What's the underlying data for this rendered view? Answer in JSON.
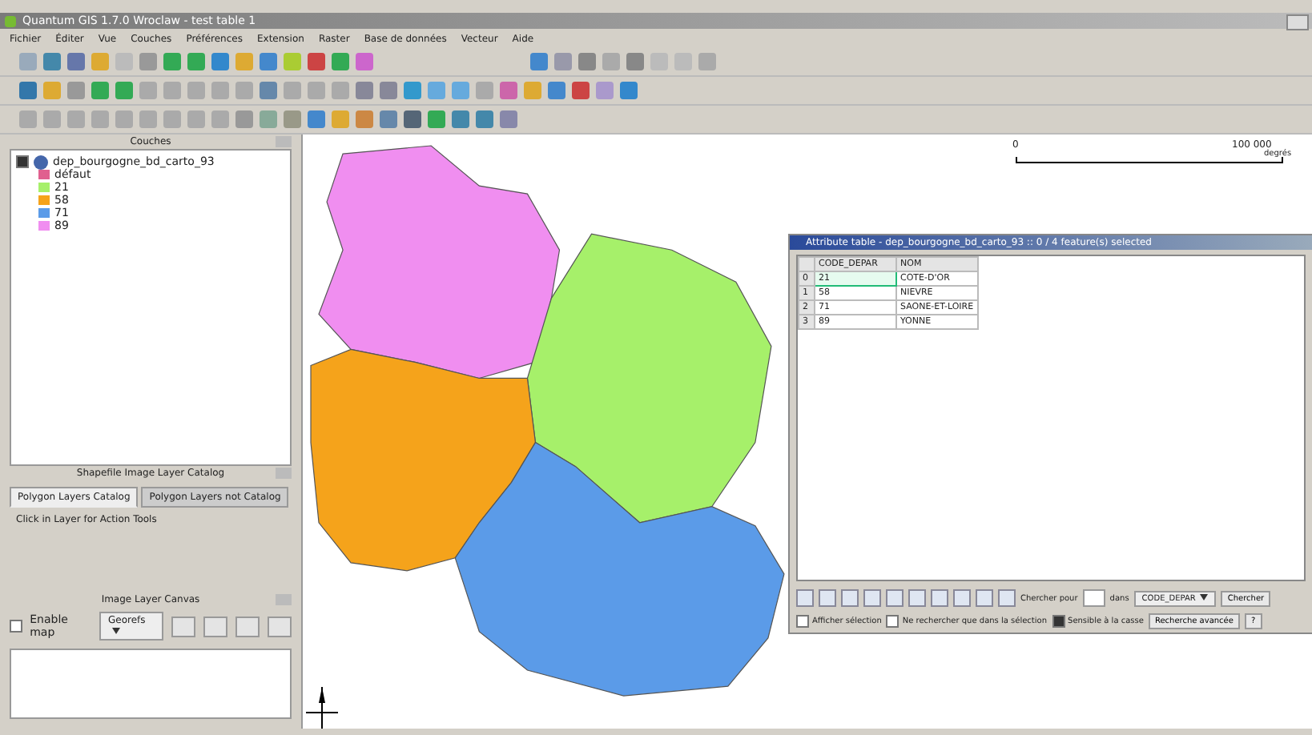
{
  "window": {
    "title": "Quantum GIS 1.7.0 Wroclaw - test table 1"
  },
  "menu": [
    "Fichier",
    "Éditer",
    "Vue",
    "Couches",
    "Préférences",
    "Extension",
    "Raster",
    "Base de données",
    "Vecteur",
    "Aide"
  ],
  "layers_panel": {
    "title": "Couches",
    "layer": {
      "name": "dep_bourgogne_bd_carto_93",
      "checked": true
    },
    "classes": [
      {
        "label": "défaut",
        "color": "#e0608f"
      },
      {
        "label": "21",
        "color": "#a6f06a"
      },
      {
        "label": "58",
        "color": "#f5a31b"
      },
      {
        "label": "71",
        "color": "#5b9be8"
      },
      {
        "label": "89",
        "color": "#f08ef0"
      }
    ]
  },
  "catalog_panel": {
    "title": "Shapefile Image Layer Catalog",
    "tabs": [
      {
        "label": "Polygon Layers Catalog",
        "selected": true
      },
      {
        "label": "Polygon Layers not Catalog",
        "selected": false
      }
    ],
    "hint": "Click in Layer for Action Tools"
  },
  "canvas_panel": {
    "title": "Image Layer Canvas",
    "enable_map": {
      "label": "Enable map",
      "checked": false
    },
    "combo": "Georefs"
  },
  "scale_bar": {
    "start": "0",
    "end": "100 000",
    "unit": "degrés"
  },
  "map": {
    "regions": [
      {
        "color": "#f08ef0"
      },
      {
        "color": "#a6f06a"
      },
      {
        "color": "#f5a31b"
      },
      {
        "color": "#5b9be8"
      }
    ]
  },
  "attribute_table": {
    "title": "Attribute table - dep_bourgogne_bd_carto_93 :: 0 / 4 feature(s) selected",
    "columns": [
      "CODE_DEPAR",
      "NOM"
    ],
    "rows": [
      {
        "index": "0",
        "cells": [
          "21",
          "COTE-D'OR"
        ],
        "current": true
      },
      {
        "index": "1",
        "cells": [
          "58",
          "NIEVRE"
        ],
        "current": false
      },
      {
        "index": "2",
        "cells": [
          "71",
          "SAONE-ET-LOIRE"
        ],
        "current": false
      },
      {
        "index": "3",
        "cells": [
          "89",
          "YONNE"
        ],
        "current": false
      }
    ],
    "search": {
      "label": "Chercher pour",
      "in_label": "dans",
      "field": "CODE_DEPAR",
      "button": "Chercher"
    },
    "options": [
      {
        "label": "Afficher sélection",
        "checked": false
      },
      {
        "label": "Ne rechercher que dans la sélection",
        "checked": false
      },
      {
        "label": "Sensible à la casse",
        "checked": true
      }
    ],
    "buttons": [
      "Recherche avancée",
      "?"
    ]
  }
}
